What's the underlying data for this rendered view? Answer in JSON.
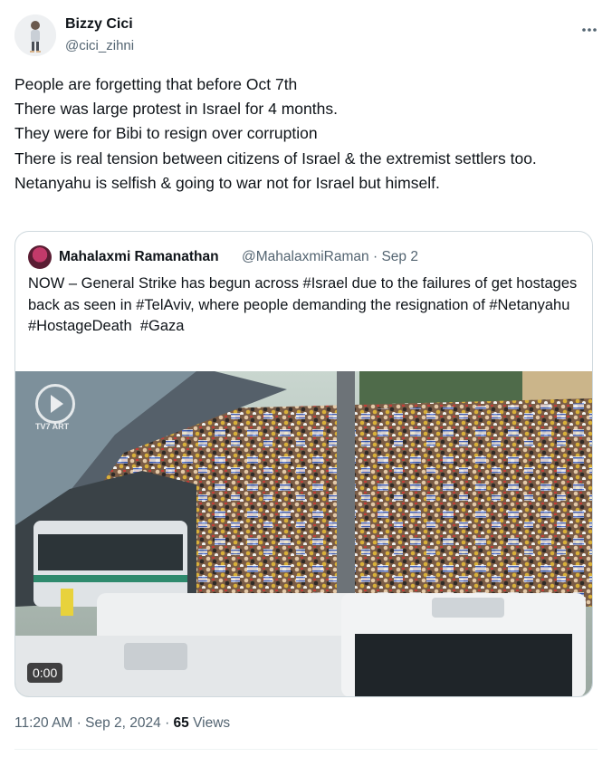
{
  "author": {
    "display_name": "Bizzy Cici",
    "handle": "@cici_zihni",
    "more_icon": "ellipsis-icon"
  },
  "tweet": {
    "text": "People are forgetting that before Oct 7th\nThere was large protest in Israel for 4 months.\nThey were for Bibi to resign over corruption\nThere is real tension between citizens of Israel & the extremist settlers too.\nNetanyahu is selfish & going to war not for Israel but himself."
  },
  "quoted": {
    "display_name": "Mahalaxmi Ramanathan",
    "handle": "@MahalaxmiRaman",
    "separator": "·",
    "date": "Sep 2",
    "text": "NOW – General Strike has begun across #Israel due to the failures of get hostages back as seen in #TelAviv, where people demanding the resignation of #Netanyahu\n#HostageDeath  #Gaza",
    "media": {
      "video_time": "0:00",
      "watermark": "TV7 ART"
    }
  },
  "footer": {
    "time": "11:20 AM",
    "sep1": "·",
    "date": "Sep 2, 2024",
    "sep2": "·",
    "views_count": "65",
    "views_label": "Views"
  },
  "colors": {
    "text": "#0f1419",
    "secondary": "#536471",
    "border": "#cfd9de"
  }
}
